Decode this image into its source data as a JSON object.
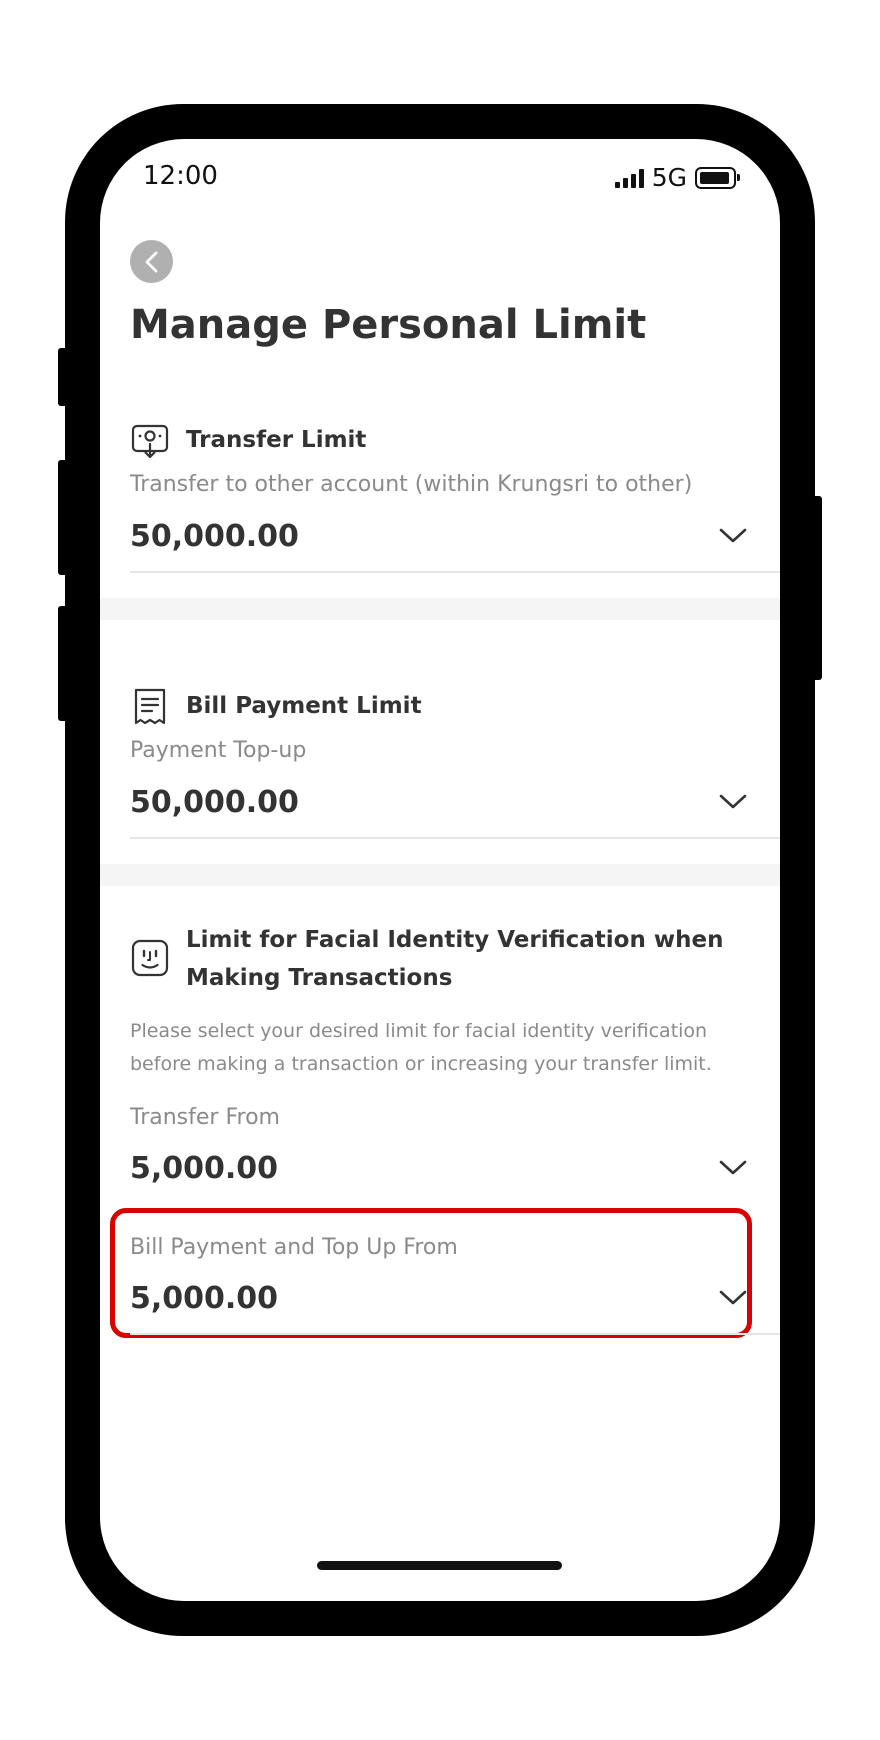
{
  "status_bar": {
    "time": "12:00",
    "network": "5G"
  },
  "header": {
    "title": "Manage Personal Limit"
  },
  "transfer_limit": {
    "title": "Transfer Limit",
    "field_label": "Transfer to other account (within Krungsri to other)",
    "field_value": "50,000.00"
  },
  "bill_payment_limit": {
    "title": "Bill Payment Limit",
    "field_label": "Payment Top-up",
    "field_value": "50,000.00"
  },
  "facial_limit": {
    "title_line1": "Limit for Facial Identity Verification when",
    "title_line2": "Making Transactions",
    "desc_line1": "Please select your desired limit for facial identity verification",
    "desc_line2": "before making a transaction or increasing your transfer limit.",
    "transfer_from_label": "Transfer From",
    "transfer_from_value": "5,000.00",
    "bill_topup_label": "Bill Payment and Top Up From",
    "bill_topup_value": "5,000.00"
  },
  "colors": {
    "highlight": "#d90000",
    "text": "#333333",
    "muted": "#8a8a8a",
    "back_button": "#b0b0b0"
  }
}
